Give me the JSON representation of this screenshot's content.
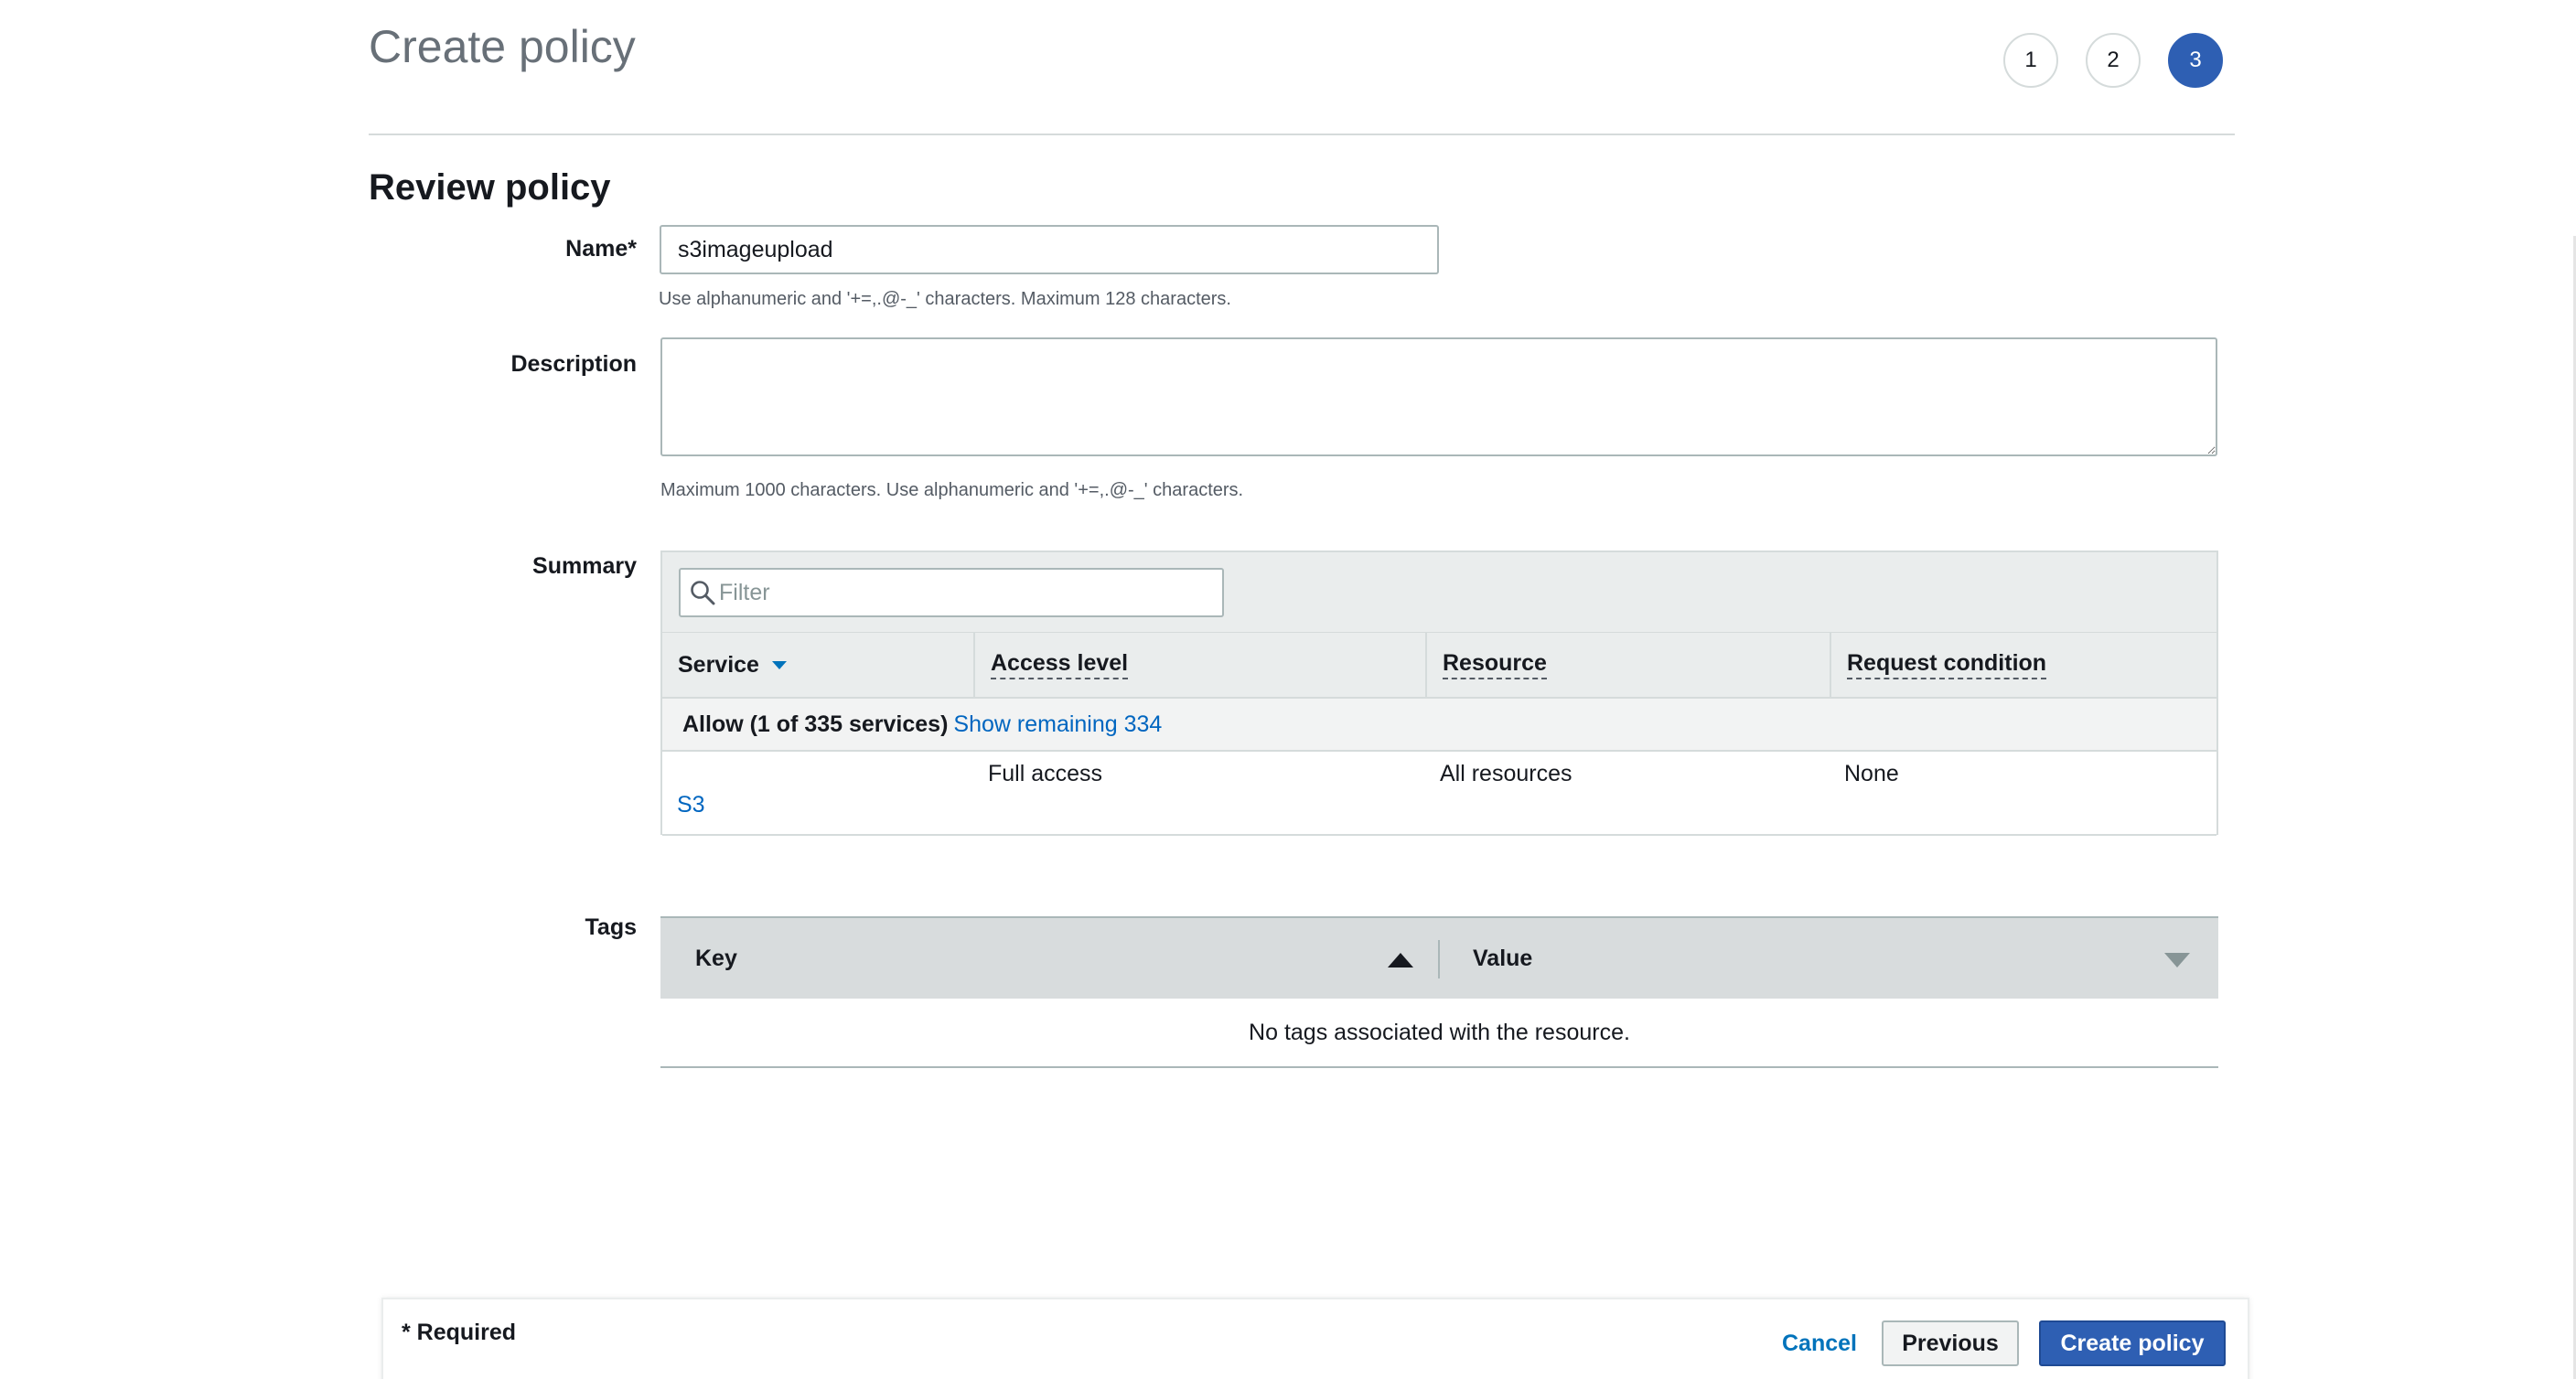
{
  "header": {
    "title": "Create policy",
    "steps": [
      "1",
      "2",
      "3"
    ],
    "active_step": "3"
  },
  "review": {
    "title": "Review policy",
    "name_label": "Name*",
    "name_value": "s3imageupload",
    "name_hint": "Use alphanumeric and '+=,.@-_' characters. Maximum 128 characters.",
    "description_label": "Description",
    "description_value": "",
    "description_hint": "Maximum 1000 characters. Use alphanumeric and '+=,.@-_' characters."
  },
  "summary": {
    "label": "Summary",
    "filter_placeholder": "Filter",
    "columns": [
      "Service",
      "Access level",
      "Resource",
      "Request condition"
    ],
    "allow_text": "Allow (1 of 335 services)",
    "show_remaining": "Show remaining 334",
    "rows": [
      {
        "service": "S3",
        "access_level": "Full access",
        "resource": "All resources",
        "request_condition": "None"
      }
    ]
  },
  "tags": {
    "label": "Tags",
    "columns": [
      "Key",
      "Value"
    ],
    "empty_message": "No tags associated with the resource."
  },
  "footer": {
    "required": "* Required",
    "cancel": "Cancel",
    "previous": "Previous",
    "create": "Create policy"
  },
  "colors": {
    "primary": "#2e5fb3",
    "link": "#0066c0",
    "header_bg": "#eaeded"
  },
  "icons": [
    "search-icon",
    "sort-down-icon",
    "sort-asc-icon",
    "sort-desc-icon"
  ]
}
